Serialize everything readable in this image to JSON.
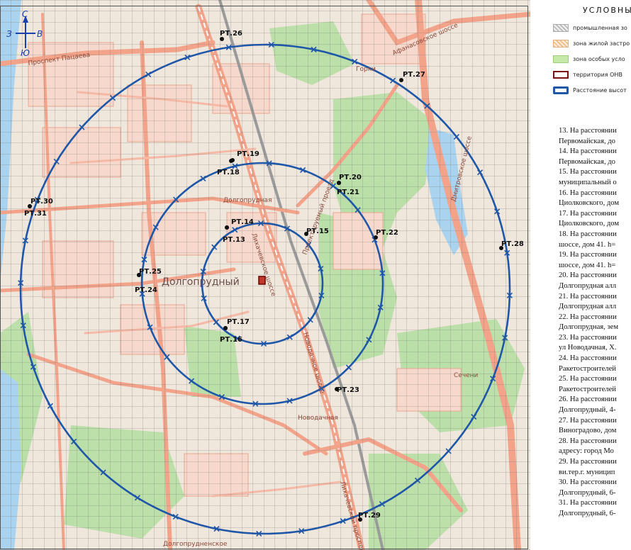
{
  "map": {
    "compass": {
      "north": "С",
      "south": "Ю",
      "west": "З",
      "east": "В"
    },
    "city_label": "Долгопрудный",
    "place_labels": [
      "Долгопрудная",
      "Долгопрудненское",
      "Новодачная",
      "Сечени",
      "Горки"
    ],
    "street_labels": [
      "Проспект Пацаева",
      "Лихачевское шоссе",
      "Новодачное шоссе",
      "Проектируемый проезд",
      "Дмитровское шоссе",
      "Афанасовское шоссе",
      "Лихачевский проспект"
    ],
    "points": [
      "РТ.26",
      "РТ.27",
      "РТ.19",
      "РТ.18",
      "РТ.20",
      "РТ.21",
      "РТ.30",
      "РТ.31",
      "РТ.14",
      "РТ.13",
      "РТ.15",
      "РТ.22",
      "РТ.28",
      "РТ.25",
      "РТ.24",
      "РТ.17",
      "РТ.16",
      "РТ.23",
      "РТ.29"
    ],
    "colors": {
      "ring": "#1f57a8",
      "map_bg": "#efe6dc",
      "green": "#b9dfa6",
      "water": "#a9d3ee",
      "road": "#f2a38a",
      "grid": "#7a7a7a"
    }
  },
  "legend": {
    "title": "УСЛОВНЫ",
    "items": [
      {
        "label": "промышленная зо",
        "icon": "hatched-gray-swatch"
      },
      {
        "label": "зона жилой застро",
        "icon": "hatched-orange-swatch"
      },
      {
        "label": "зона особых усло",
        "icon": "green-swatch"
      },
      {
        "label": "территория ОНВ",
        "icon": "dark-red-outline-swatch"
      },
      {
        "label": "Расстояние высот",
        "icon": "blue-outline-swatch"
      }
    ]
  },
  "notes": [
    "13. На расстоянии",
    "Первомайская, до",
    "14. На расстоянии",
    "Первомайская, до",
    "15. На расстоянии",
    "муниципальный о",
    "16. На расстоянии",
    "Циолковского, дом",
    "17. На расстоянии",
    "Циолковского, дом",
    "18. На расстоянии",
    "шоссе, дом 41. h=",
    "19. На расстоянии",
    "шоссе, дом 41. h=",
    "20. На расстоянии",
    "Долгопрудная алл",
    "21. На расстоянии",
    "Долгопрудная алл",
    "22. На расстоянии",
    "Долгопрудная, зем",
    "23. На расстоянии",
    "ул Новодачная, Х.",
    "24. На расстоянии",
    "Ракетостроителей",
    "25. На расстоянии",
    "Ракетостроителей",
    "26. На расстоянии",
    "Долгопрудный, 4-",
    "27. На расстоянии",
    "Виноградово, дом",
    "28. На расстоянии",
    "адресу: город Мо",
    "29. На расстоянии",
    "ви.тер.г. муницип",
    "30. На расстоянии",
    "Долгопрудный, 6-",
    "31. На расстоянии",
    "Долгопрудный, 6-"
  ]
}
